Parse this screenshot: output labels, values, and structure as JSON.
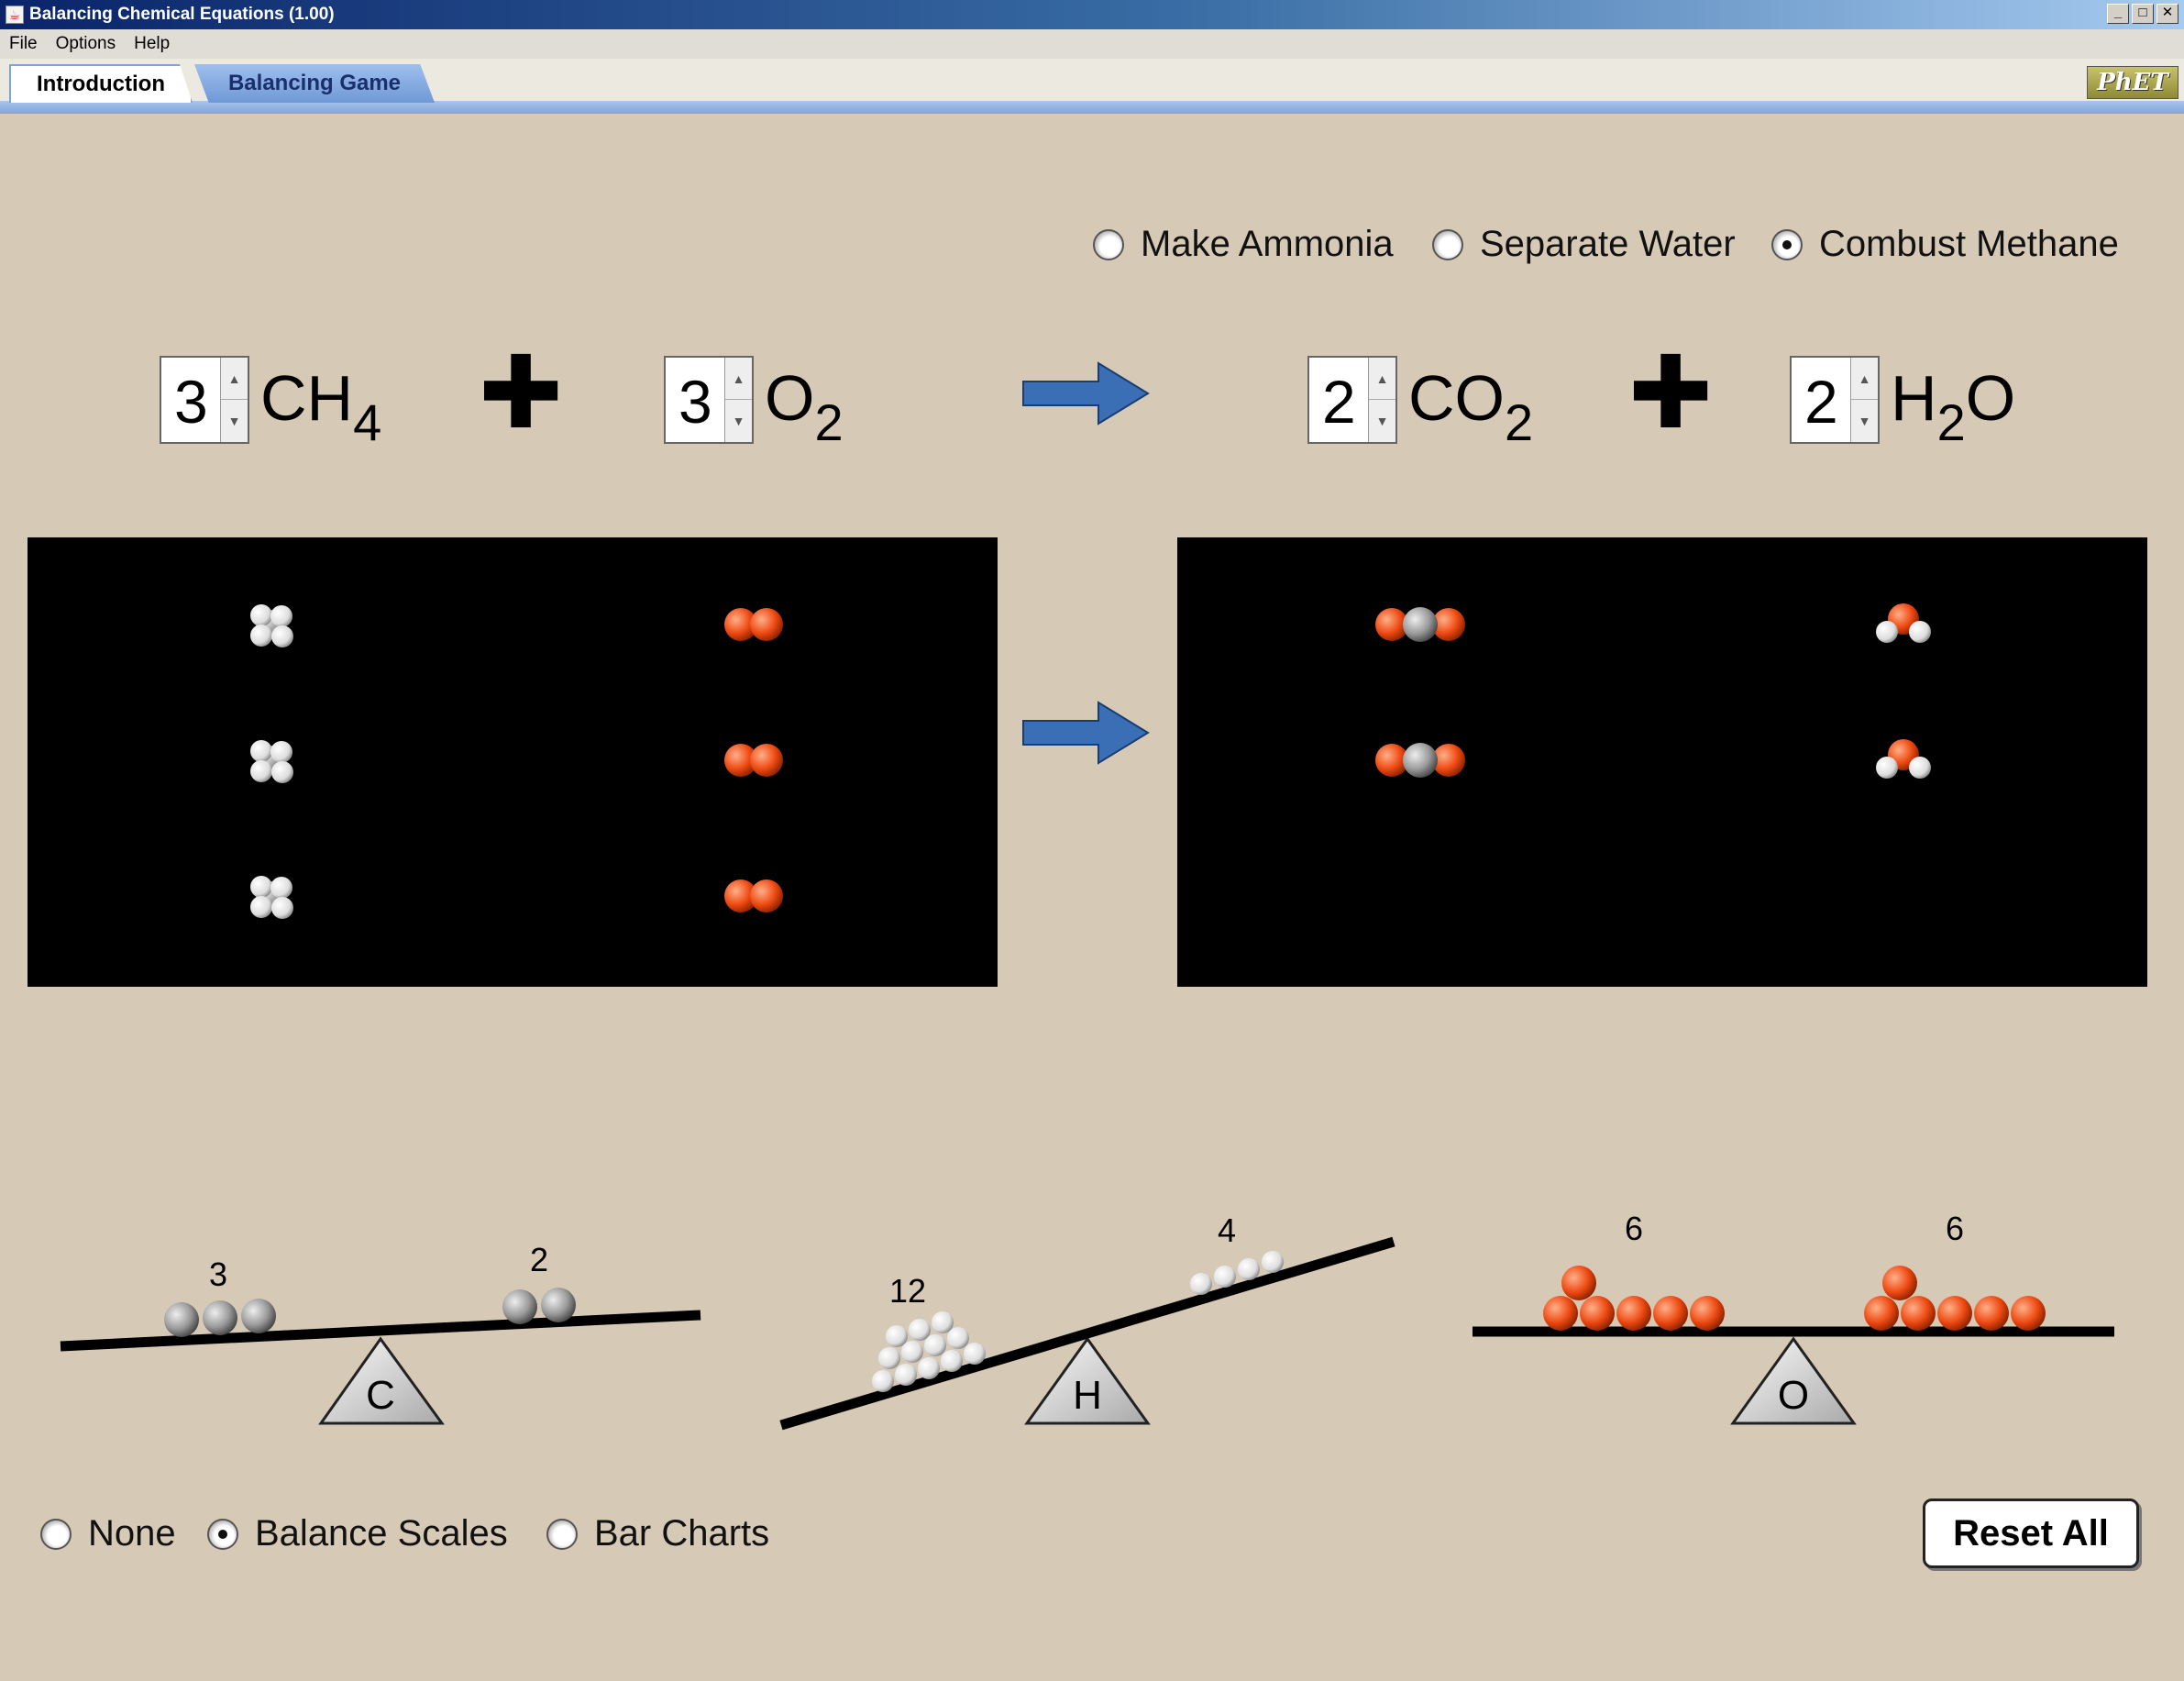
{
  "window": {
    "title": "Balancing Chemical Equations (1.00)"
  },
  "menu": {
    "items": [
      "File",
      "Options",
      "Help"
    ]
  },
  "tabs": {
    "items": [
      {
        "label": "Introduction",
        "active": true
      },
      {
        "label": "Balancing Game",
        "active": false
      }
    ]
  },
  "logo": {
    "text": "PhET"
  },
  "reactions": {
    "options": [
      {
        "label": "Make Ammonia",
        "selected": false
      },
      {
        "label": "Separate Water",
        "selected": false
      },
      {
        "label": "Combust Methane",
        "selected": true
      }
    ]
  },
  "equation": {
    "reactants": [
      {
        "coefficient": "3",
        "formula": "CH",
        "subscript": "4",
        "suffix": ""
      },
      {
        "coefficient": "3",
        "formula": "O",
        "subscript": "2",
        "suffix": ""
      }
    ],
    "products": [
      {
        "coefficient": "2",
        "formula": "CO",
        "subscript": "2",
        "suffix": ""
      },
      {
        "coefficient": "2",
        "formula": "H",
        "subscript": "2",
        "suffix": "O"
      }
    ]
  },
  "scales": [
    {
      "element": "C",
      "left_count": "3",
      "right_count": "2"
    },
    {
      "element": "H",
      "left_count": "12",
      "right_count": "4"
    },
    {
      "element": "O",
      "left_count": "6",
      "right_count": "6"
    }
  ],
  "views": {
    "options": [
      {
        "label": "None",
        "selected": false
      },
      {
        "label": "Balance Scales",
        "selected": true
      },
      {
        "label": "Bar Charts",
        "selected": false
      }
    ]
  },
  "reset": {
    "label": "Reset All"
  },
  "colors": {
    "oxygen": "#ee4a12",
    "carbon": "#9a9a9a",
    "hydrogen": "#ffffff",
    "arrow": "#3a6fb5"
  }
}
